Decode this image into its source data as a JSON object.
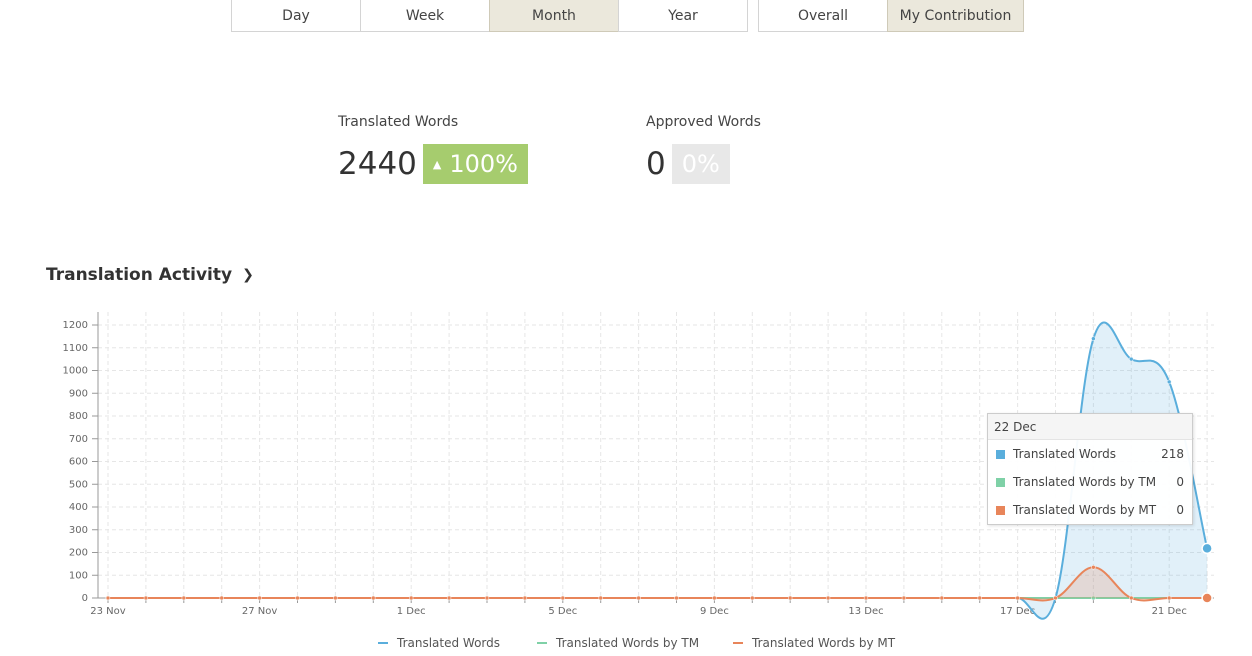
{
  "period_tabs": [
    {
      "label": "Day",
      "active": false
    },
    {
      "label": "Week",
      "active": false
    },
    {
      "label": "Month",
      "active": true
    },
    {
      "label": "Year",
      "active": false
    }
  ],
  "scope_tabs": [
    {
      "label": "Overall",
      "active": false
    },
    {
      "label": "My Contribution",
      "active": true
    }
  ],
  "stats": {
    "translated": {
      "label": "Translated Words",
      "value": "2440",
      "change": "100%",
      "trend": "up"
    },
    "approved": {
      "label": "Approved Words",
      "value": "0",
      "change": "0%"
    }
  },
  "section": {
    "title": "Translation Activity"
  },
  "tooltip": {
    "date": "22 Dec",
    "rows": [
      {
        "name": "Translated Words",
        "value": "218"
      },
      {
        "name": "Translated Words by TM",
        "value": "0"
      },
      {
        "name": "Translated Words by MT",
        "value": "0"
      }
    ]
  },
  "colors": {
    "translated": "#5aaedc",
    "tm": "#7fd1a7",
    "mt": "#e8855a",
    "active_tab": "#ebe8dc",
    "badge_green": "#a6cc6e"
  },
  "chart_data": {
    "type": "area",
    "x_tick_labels": [
      "23 Nov",
      "27 Nov",
      "1 Dec",
      "5 Dec",
      "9 Dec",
      "13 Dec",
      "17 Dec",
      "21 Dec"
    ],
    "y_ticks": [
      0,
      100,
      200,
      300,
      400,
      500,
      600,
      700,
      800,
      900,
      1000,
      1100,
      1200
    ],
    "ylim": [
      0,
      1250
    ],
    "x": [
      "23 Nov",
      "24 Nov",
      "25 Nov",
      "26 Nov",
      "27 Nov",
      "28 Nov",
      "29 Nov",
      "30 Nov",
      "1 Dec",
      "2 Dec",
      "3 Dec",
      "4 Dec",
      "5 Dec",
      "6 Dec",
      "7 Dec",
      "8 Dec",
      "9 Dec",
      "10 Dec",
      "11 Dec",
      "12 Dec",
      "13 Dec",
      "14 Dec",
      "15 Dec",
      "16 Dec",
      "17 Dec",
      "18 Dec",
      "19 Dec",
      "20 Dec",
      "21 Dec",
      "22 Dec"
    ],
    "series": [
      {
        "name": "Translated Words",
        "values": [
          0,
          0,
          0,
          0,
          0,
          0,
          0,
          0,
          0,
          0,
          0,
          0,
          0,
          0,
          0,
          0,
          0,
          0,
          0,
          0,
          0,
          0,
          0,
          0,
          0,
          0,
          1140,
          1050,
          950,
          218
        ]
      },
      {
        "name": "Translated Words by TM",
        "values": [
          0,
          0,
          0,
          0,
          0,
          0,
          0,
          0,
          0,
          0,
          0,
          0,
          0,
          0,
          0,
          0,
          0,
          0,
          0,
          0,
          0,
          0,
          0,
          0,
          0,
          0,
          0,
          0,
          0,
          0
        ]
      },
      {
        "name": "Translated Words by MT",
        "values": [
          0,
          0,
          0,
          0,
          0,
          0,
          0,
          0,
          0,
          0,
          0,
          0,
          0,
          0,
          0,
          0,
          0,
          0,
          0,
          0,
          0,
          0,
          0,
          0,
          0,
          0,
          135,
          0,
          0,
          0
        ]
      }
    ],
    "legend_position": "bottom",
    "grid": true
  }
}
